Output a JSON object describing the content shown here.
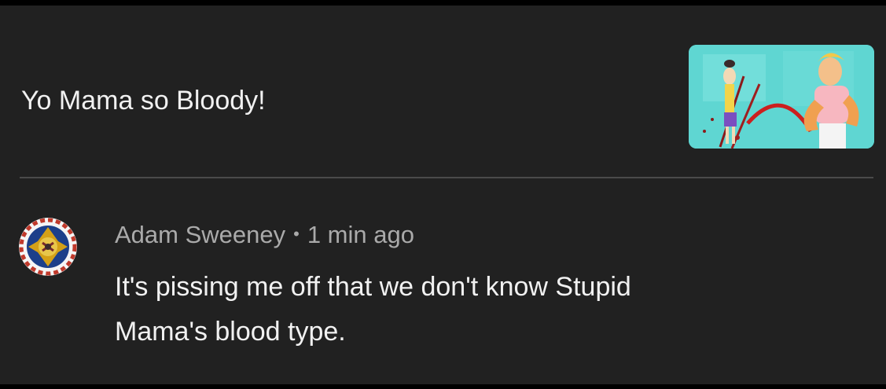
{
  "video": {
    "title": "Yo Mama so Bloody!",
    "thumbnail_icon": "cartoon-thumbnail"
  },
  "comment": {
    "author": "Adam Sweeney",
    "separator": "•",
    "time": "1 min ago",
    "text_line1": "It's pissing me off that we don't know Stupid",
    "text_line2": "Mama's blood type.",
    "avatar_icon": "beyblade-avatar-icon"
  },
  "colors": {
    "background": "#212121",
    "primary_text": "#f1f1f1",
    "secondary_text": "#aaaaaa",
    "divider": "#4a4a4a",
    "thumbnail_bg": "#5fd6d2"
  }
}
